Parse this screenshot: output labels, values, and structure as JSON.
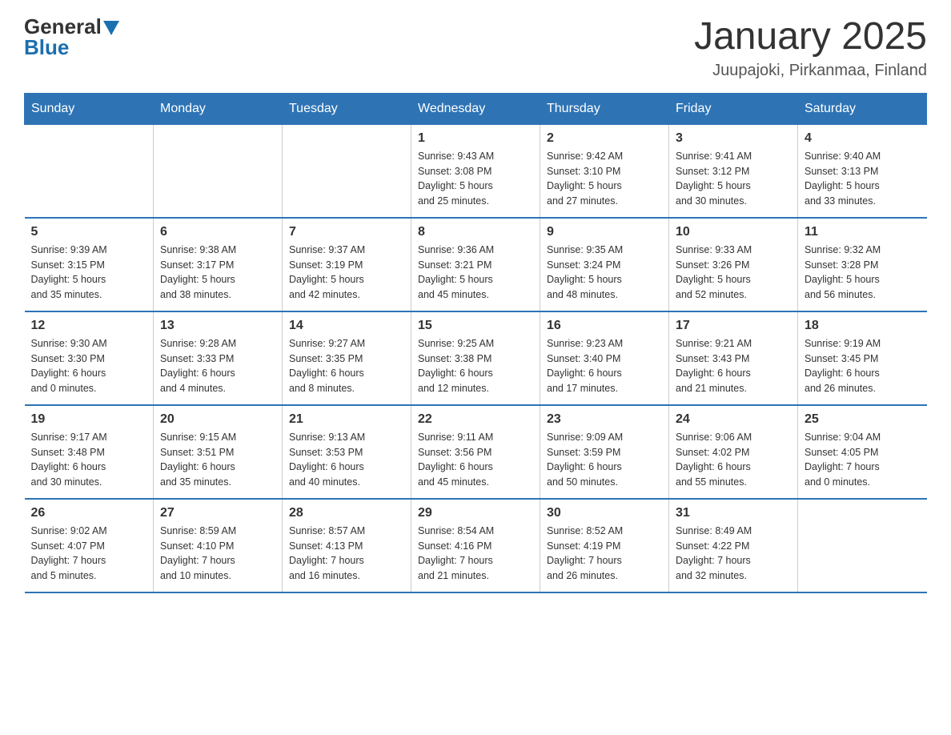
{
  "header": {
    "logo_general": "General",
    "logo_blue": "Blue",
    "title": "January 2025",
    "location": "Juupajoki, Pirkanmaa, Finland"
  },
  "weekdays": [
    "Sunday",
    "Monday",
    "Tuesday",
    "Wednesday",
    "Thursday",
    "Friday",
    "Saturday"
  ],
  "weeks": [
    [
      {
        "day": "",
        "info": ""
      },
      {
        "day": "",
        "info": ""
      },
      {
        "day": "",
        "info": ""
      },
      {
        "day": "1",
        "info": "Sunrise: 9:43 AM\nSunset: 3:08 PM\nDaylight: 5 hours\nand 25 minutes."
      },
      {
        "day": "2",
        "info": "Sunrise: 9:42 AM\nSunset: 3:10 PM\nDaylight: 5 hours\nand 27 minutes."
      },
      {
        "day": "3",
        "info": "Sunrise: 9:41 AM\nSunset: 3:12 PM\nDaylight: 5 hours\nand 30 minutes."
      },
      {
        "day": "4",
        "info": "Sunrise: 9:40 AM\nSunset: 3:13 PM\nDaylight: 5 hours\nand 33 minutes."
      }
    ],
    [
      {
        "day": "5",
        "info": "Sunrise: 9:39 AM\nSunset: 3:15 PM\nDaylight: 5 hours\nand 35 minutes."
      },
      {
        "day": "6",
        "info": "Sunrise: 9:38 AM\nSunset: 3:17 PM\nDaylight: 5 hours\nand 38 minutes."
      },
      {
        "day": "7",
        "info": "Sunrise: 9:37 AM\nSunset: 3:19 PM\nDaylight: 5 hours\nand 42 minutes."
      },
      {
        "day": "8",
        "info": "Sunrise: 9:36 AM\nSunset: 3:21 PM\nDaylight: 5 hours\nand 45 minutes."
      },
      {
        "day": "9",
        "info": "Sunrise: 9:35 AM\nSunset: 3:24 PM\nDaylight: 5 hours\nand 48 minutes."
      },
      {
        "day": "10",
        "info": "Sunrise: 9:33 AM\nSunset: 3:26 PM\nDaylight: 5 hours\nand 52 minutes."
      },
      {
        "day": "11",
        "info": "Sunrise: 9:32 AM\nSunset: 3:28 PM\nDaylight: 5 hours\nand 56 minutes."
      }
    ],
    [
      {
        "day": "12",
        "info": "Sunrise: 9:30 AM\nSunset: 3:30 PM\nDaylight: 6 hours\nand 0 minutes."
      },
      {
        "day": "13",
        "info": "Sunrise: 9:28 AM\nSunset: 3:33 PM\nDaylight: 6 hours\nand 4 minutes."
      },
      {
        "day": "14",
        "info": "Sunrise: 9:27 AM\nSunset: 3:35 PM\nDaylight: 6 hours\nand 8 minutes."
      },
      {
        "day": "15",
        "info": "Sunrise: 9:25 AM\nSunset: 3:38 PM\nDaylight: 6 hours\nand 12 minutes."
      },
      {
        "day": "16",
        "info": "Sunrise: 9:23 AM\nSunset: 3:40 PM\nDaylight: 6 hours\nand 17 minutes."
      },
      {
        "day": "17",
        "info": "Sunrise: 9:21 AM\nSunset: 3:43 PM\nDaylight: 6 hours\nand 21 minutes."
      },
      {
        "day": "18",
        "info": "Sunrise: 9:19 AM\nSunset: 3:45 PM\nDaylight: 6 hours\nand 26 minutes."
      }
    ],
    [
      {
        "day": "19",
        "info": "Sunrise: 9:17 AM\nSunset: 3:48 PM\nDaylight: 6 hours\nand 30 minutes."
      },
      {
        "day": "20",
        "info": "Sunrise: 9:15 AM\nSunset: 3:51 PM\nDaylight: 6 hours\nand 35 minutes."
      },
      {
        "day": "21",
        "info": "Sunrise: 9:13 AM\nSunset: 3:53 PM\nDaylight: 6 hours\nand 40 minutes."
      },
      {
        "day": "22",
        "info": "Sunrise: 9:11 AM\nSunset: 3:56 PM\nDaylight: 6 hours\nand 45 minutes."
      },
      {
        "day": "23",
        "info": "Sunrise: 9:09 AM\nSunset: 3:59 PM\nDaylight: 6 hours\nand 50 minutes."
      },
      {
        "day": "24",
        "info": "Sunrise: 9:06 AM\nSunset: 4:02 PM\nDaylight: 6 hours\nand 55 minutes."
      },
      {
        "day": "25",
        "info": "Sunrise: 9:04 AM\nSunset: 4:05 PM\nDaylight: 7 hours\nand 0 minutes."
      }
    ],
    [
      {
        "day": "26",
        "info": "Sunrise: 9:02 AM\nSunset: 4:07 PM\nDaylight: 7 hours\nand 5 minutes."
      },
      {
        "day": "27",
        "info": "Sunrise: 8:59 AM\nSunset: 4:10 PM\nDaylight: 7 hours\nand 10 minutes."
      },
      {
        "day": "28",
        "info": "Sunrise: 8:57 AM\nSunset: 4:13 PM\nDaylight: 7 hours\nand 16 minutes."
      },
      {
        "day": "29",
        "info": "Sunrise: 8:54 AM\nSunset: 4:16 PM\nDaylight: 7 hours\nand 21 minutes."
      },
      {
        "day": "30",
        "info": "Sunrise: 8:52 AM\nSunset: 4:19 PM\nDaylight: 7 hours\nand 26 minutes."
      },
      {
        "day": "31",
        "info": "Sunrise: 8:49 AM\nSunset: 4:22 PM\nDaylight: 7 hours\nand 32 minutes."
      },
      {
        "day": "",
        "info": ""
      }
    ]
  ]
}
